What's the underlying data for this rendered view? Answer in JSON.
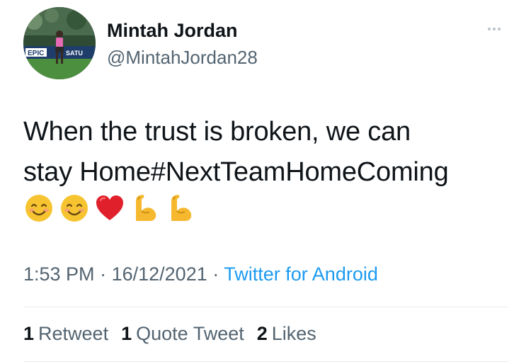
{
  "author": {
    "name": "Mintah Jordan",
    "handle": "@MintahJordan28",
    "avatar_banner_text": [
      "EPIC",
      "SATU"
    ]
  },
  "tweet": {
    "text_line1": "When the trust is broken, we can",
    "text_line2": "stay Home#NextTeamHomeComing",
    "emojis": [
      "smiling-face-icon",
      "smiling-face-icon",
      "red-heart-icon",
      "flexed-biceps-icon",
      "flexed-biceps-icon"
    ]
  },
  "meta": {
    "time": "1:53 PM",
    "separator": "·",
    "date": "16/12/2021",
    "source": "Twitter for Android"
  },
  "stats": {
    "retweets_count": "1",
    "retweets_label": "Retweet",
    "quotes_count": "1",
    "quotes_label": "Quote Tweet",
    "likes_count": "2",
    "likes_label": "Likes"
  },
  "colors": {
    "text_primary": "#0f1419",
    "text_secondary": "#536471",
    "link": "#1d9bf0",
    "divider": "#e6ecf0"
  }
}
